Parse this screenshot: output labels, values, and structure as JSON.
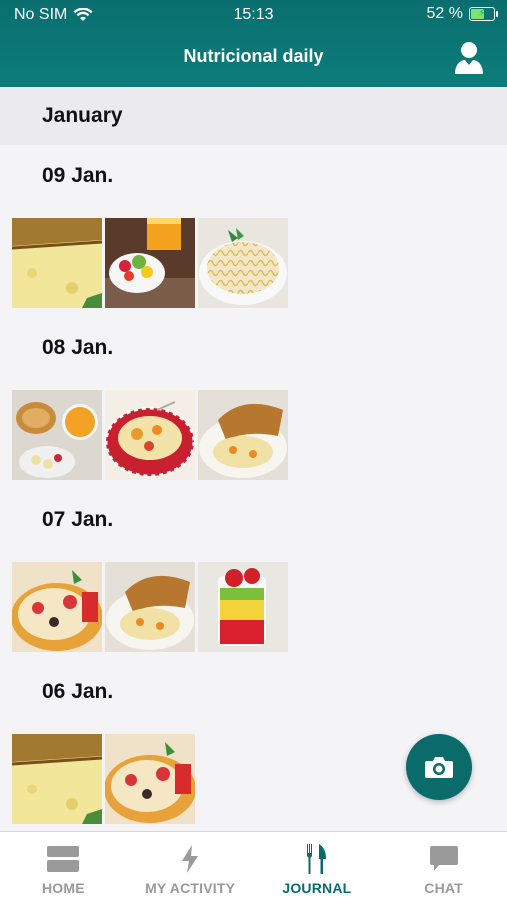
{
  "status_bar": {
    "carrier": "No SIM",
    "time": "15:13",
    "battery": "52 %"
  },
  "header": {
    "title": "Nutricional daily"
  },
  "month": "January",
  "days": [
    {
      "date": "09 Jan.",
      "photos": [
        "omelette",
        "fruit-salad-juice",
        "spaghetti"
      ]
    },
    {
      "date": "08 Jan.",
      "photos": [
        "breakfast-toast-juice",
        "tortellini",
        "chicken-vegetables"
      ]
    },
    {
      "date": "07 Jan.",
      "photos": [
        "pasta-salad",
        "chicken-vegetables",
        "fruit-cup"
      ]
    },
    {
      "date": "06 Jan.",
      "photos": [
        "omelette",
        "pasta-salad"
      ]
    }
  ],
  "tabbar": {
    "items": [
      {
        "label": "HOME",
        "icon": "home-icon"
      },
      {
        "label": "MY ACTIVITY",
        "icon": "lightning-icon"
      },
      {
        "label": "JOURNAL",
        "icon": "fork-knife-icon",
        "active": true
      },
      {
        "label": "CHAT",
        "icon": "chat-bubble-icon"
      }
    ]
  },
  "colors": {
    "primary": "#0b6b6b",
    "inactive": "#9a9a9a"
  }
}
